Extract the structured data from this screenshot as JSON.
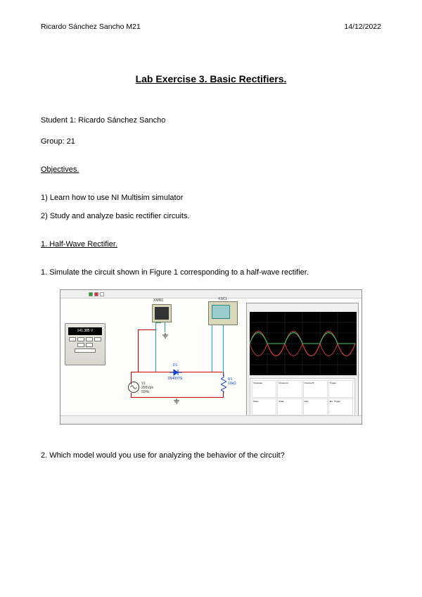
{
  "header": {
    "author": "Ricardo Sánchez Sancho M21",
    "date": "14/12/2022"
  },
  "title": "Lab Exercise 3. Basic Rectifiers.",
  "student_line": "Student 1: Ricardo Sánchez Sancho",
  "group_line": "Group:   21",
  "objectives_heading": "Objectives.",
  "objectives": {
    "o1": "1) Learn how to use NI Multisim simulator",
    "o2": "2) Study and analyze basic rectifier circuits."
  },
  "section1_heading": "1. Half-Wave Rectifier.",
  "q1": "1. Simulate the circuit shown in Figure 1 corresponding to a half-wave rectifier.",
  "q2": "2. Which model would you use for analyzing the behavior of the circuit?",
  "sim": {
    "multimeter_label": "XMM1",
    "scope_label": "XSC1",
    "mm_reading": "141.385 V",
    "diode_ref": "D1",
    "diode_part": "1N4007G",
    "source_ref": "V1",
    "source_v": "200Vpk",
    "source_f": "50Hz",
    "res_ref": "R1",
    "res_val": "10kΩ",
    "scope_cells": {
      "c1": "Channel A",
      "c2": "Channel B",
      "c3": "Timebase",
      "c4": "Trigger",
      "c5": "Scale",
      "c6": "Scale",
      "c7": "Add",
      "c8": "Ext. Trigger"
    }
  }
}
